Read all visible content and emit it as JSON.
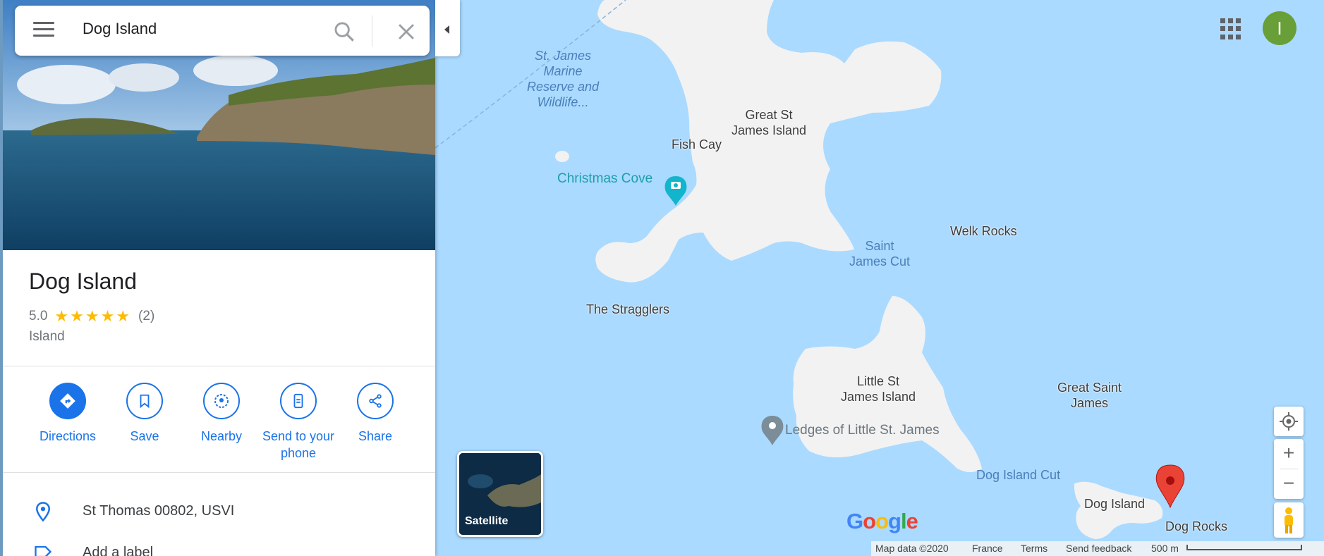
{
  "search": {
    "query": "Dog Island"
  },
  "place": {
    "title": "Dog Island",
    "rating": "5.0",
    "stars": "★★★★★",
    "rating_fraction": 1.0,
    "review_count": "(2)",
    "category": "Island"
  },
  "actions": [
    {
      "label": "Directions",
      "icon": "directions-icon"
    },
    {
      "label": "Save",
      "icon": "bookmark-icon"
    },
    {
      "label": "Nearby",
      "icon": "nearby-icon"
    },
    {
      "label": "Send to your phone",
      "icon": "send-to-phone-icon"
    },
    {
      "label": "Share",
      "icon": "share-icon"
    }
  ],
  "info": {
    "address": "St Thomas 00802, USVI",
    "add_label": "Add a label"
  },
  "account": {
    "initial": "I",
    "color": "#689f38"
  },
  "map": {
    "labels": {
      "marine_reserve": "St. James\nMarine\nReserve and\nWildlife...",
      "great_st_james": "Great St\nJames Island",
      "fish_cay": "Fish Cay",
      "christmas_cove": "Christmas Cove",
      "saint_james_cut": "Saint\nJames Cut",
      "welk_rocks": "Welk Rocks",
      "stragglers": "The Stragglers",
      "little_st_james": "Little St\nJames Island",
      "ledges": "Ledges of Little St. James",
      "great_saint_james": "Great Saint\nJames",
      "dog_island_cut": "Dog Island Cut",
      "dog_island": "Dog Island",
      "dog_rocks": "Dog Rocks"
    },
    "satellite_label": "Satellite",
    "logo": "Google",
    "colors": {
      "water": "#aadaff",
      "land": "#f2f2f2",
      "pin": "#ea4335",
      "accent": "#1a73e8"
    }
  },
  "footer": {
    "map_data": "Map data ©2020",
    "region": "France",
    "terms": "Terms",
    "feedback": "Send feedback",
    "scale": "500 m"
  }
}
